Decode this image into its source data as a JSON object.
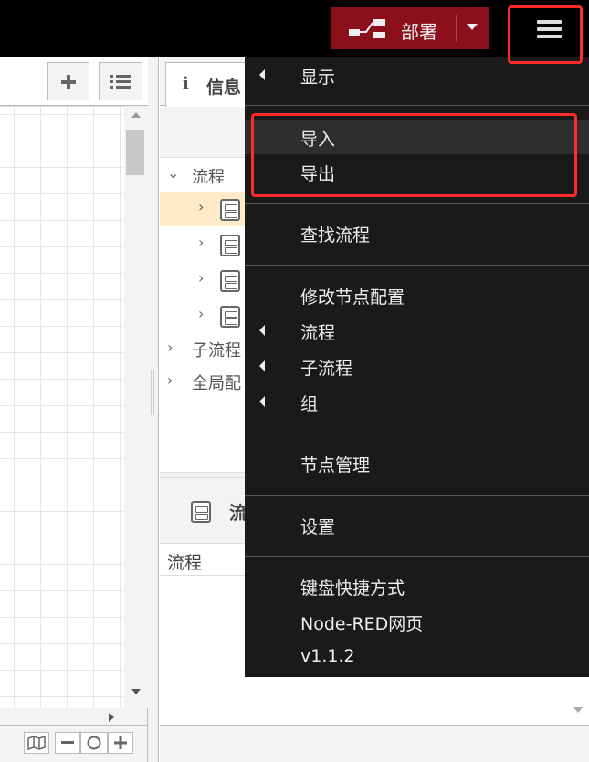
{
  "header": {
    "deploy_label": "部署"
  },
  "sidebar": {
    "info_tab_icon": "i",
    "info_tab_label": "信息",
    "tree": [
      {
        "label": "流程",
        "chevron": "⌄"
      },
      {
        "label": "",
        "chevron": "›"
      },
      {
        "label": "",
        "chevron": "›"
      },
      {
        "label": "",
        "chevron": "›"
      },
      {
        "label": "",
        "chevron": "›"
      },
      {
        "label": "子流程",
        "chevron": "›"
      },
      {
        "label": "全局配",
        "chevron": "›"
      }
    ],
    "help_title": "流",
    "help_body_label": "流程"
  },
  "menu": {
    "items": [
      {
        "label": "显示"
      },
      {
        "label": "导入"
      },
      {
        "label": "导出"
      },
      {
        "label": "查找流程"
      },
      {
        "label": "修改节点配置"
      },
      {
        "label": "流程"
      },
      {
        "label": "子流程"
      },
      {
        "label": "组"
      },
      {
        "label": "节点管理"
      },
      {
        "label": "设置"
      },
      {
        "label": "键盘快捷方式"
      },
      {
        "label": "Node-RED网页"
      },
      {
        "label": "v1.1.2"
      }
    ]
  },
  "colors": {
    "header_bg": "#000000",
    "deploy_bg": "#8c101c",
    "menu_bg": "#1a1a1a",
    "highlight_outline": "#ff2a2a",
    "selected_row": "#ffebc7"
  }
}
